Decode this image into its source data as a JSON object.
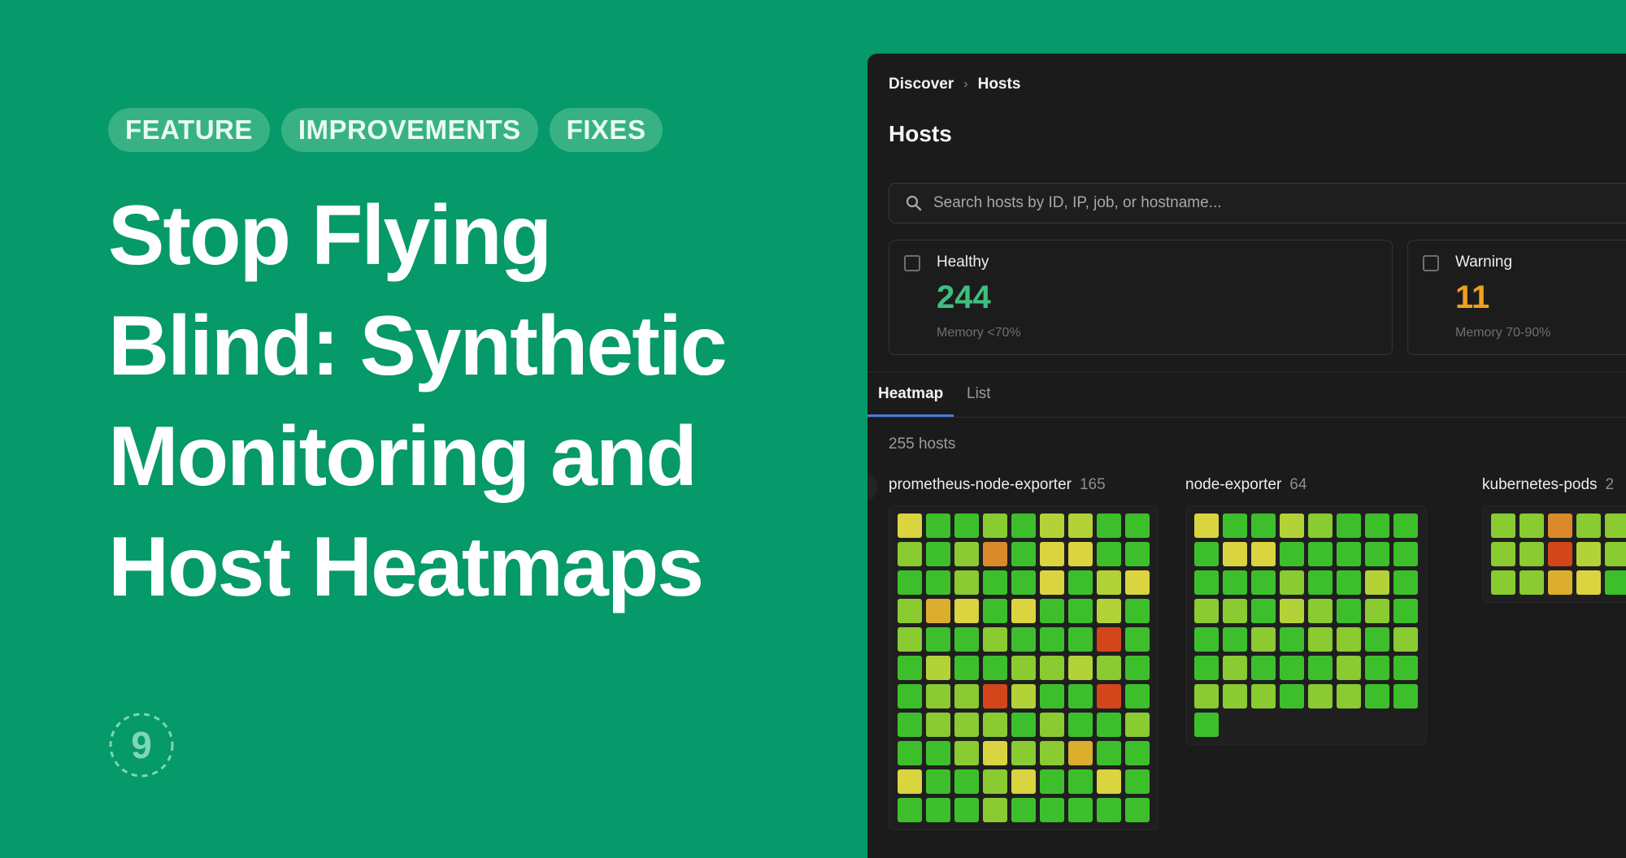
{
  "tags": [
    "FEATURE",
    "IMPROVEMENTS",
    "FIXES"
  ],
  "headline": [
    "Stop Flying",
    "Blind: Synthetic",
    "Monitoring and",
    "Host Heatmaps"
  ],
  "logo": {
    "glyph": "9",
    "color": "#7ED7B5"
  },
  "panel": {
    "breadcrumb": {
      "root": "Discover",
      "current": "Hosts"
    },
    "title": "Hosts",
    "search": {
      "placeholder": "Search hosts by ID, IP, job, or hostname...",
      "value": ""
    },
    "stats": [
      {
        "label": "Healthy",
        "value": "244",
        "sub": "Memory <70%",
        "color": "#3FBF7F"
      },
      {
        "label": "Warning",
        "value": "11",
        "sub": "Memory 70-90%",
        "color": "#F0A020"
      }
    ],
    "tabs": {
      "active": "Heatmap",
      "inactive": "List"
    },
    "host_count": "255 hosts",
    "groups": [
      {
        "name": "prometheus-node-exporter",
        "count": "165",
        "cols": 9,
        "cells": [
          [
            "yellow",
            "green",
            "green",
            "lime",
            "green",
            "chart",
            "chart",
            "green",
            "green"
          ],
          [
            "lime",
            "green",
            "lime",
            "orange",
            "green",
            "yellow",
            "yellow",
            "green",
            "green"
          ],
          [
            "green",
            "green",
            "lime",
            "green",
            "green",
            "yellow",
            "green",
            "chart",
            "yellow"
          ],
          [
            "lime",
            "amber",
            "yellow",
            "green",
            "yellow",
            "green",
            "green",
            "chart",
            "green"
          ],
          [
            "lime",
            "green",
            "green",
            "lime",
            "green",
            "green",
            "green",
            "red",
            "green"
          ],
          [
            "green",
            "chart",
            "green",
            "green",
            "lime",
            "lime",
            "chart",
            "lime",
            "green"
          ],
          [
            "green",
            "lime",
            "lime",
            "red",
            "chart",
            "green",
            "green",
            "red",
            "green"
          ],
          [
            "green",
            "lime",
            "lime",
            "lime",
            "green",
            "lime",
            "green",
            "green",
            "lime"
          ],
          [
            "green",
            "green",
            "lime",
            "yellow",
            "lime",
            "lime",
            "amber",
            "green",
            "green"
          ],
          [
            "yellow",
            "green",
            "green",
            "lime",
            "yellow",
            "green",
            "green",
            "yellow",
            "green"
          ],
          [
            "green",
            "green",
            "green",
            "lime",
            "green",
            "green",
            "green",
            "green",
            "green"
          ]
        ]
      },
      {
        "name": "node-exporter",
        "count": "64",
        "cols": 8,
        "cells": [
          [
            "yellow",
            "green",
            "green",
            "chart",
            "lime",
            "green",
            "green",
            "green"
          ],
          [
            "green",
            "yellow",
            "yellow",
            "green",
            "green",
            "green",
            "green",
            "green"
          ],
          [
            "green",
            "green",
            "green",
            "lime",
            "green",
            "green",
            "chart",
            "green"
          ],
          [
            "lime",
            "lime",
            "green",
            "chart",
            "lime",
            "green",
            "lime",
            "green"
          ],
          [
            "green",
            "green",
            "lime",
            "green",
            "lime",
            "lime",
            "green",
            "lime"
          ],
          [
            "green",
            "lime",
            "green",
            "green",
            "green",
            "lime",
            "green",
            "green"
          ],
          [
            "lime",
            "lime",
            "lime",
            "green",
            "lime",
            "lime",
            "green",
            "green"
          ],
          [
            "green"
          ]
        ]
      },
      {
        "name": "kubernetes-pods",
        "count": "2",
        "cols": 5,
        "cells": [
          [
            "lime",
            "lime",
            "orange",
            "lime",
            "lime"
          ],
          [
            "lime",
            "lime",
            "red",
            "chart",
            "lime"
          ],
          [
            "lime",
            "lime",
            "amber",
            "yellow",
            "green"
          ]
        ]
      }
    ]
  }
}
